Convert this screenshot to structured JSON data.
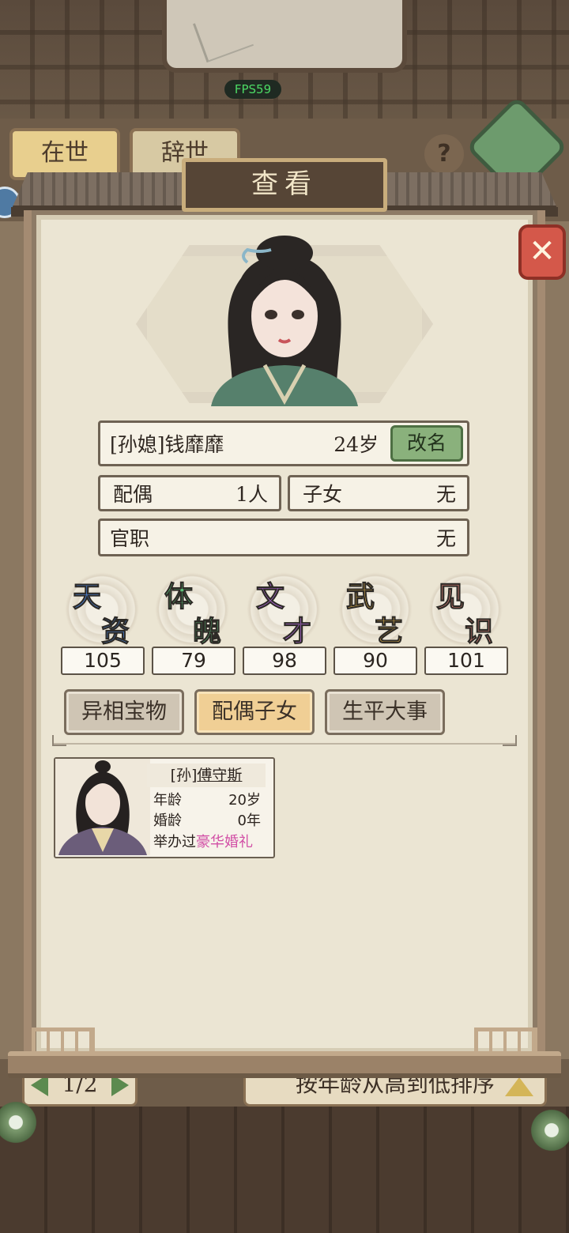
{
  "hud": {
    "fps": "FPS59"
  },
  "background": {
    "tabs": [
      "在世",
      "辞世"
    ],
    "help_icon": "question-mark-icon",
    "back_icon": "return-arrow-icon",
    "pager": "1/2",
    "sort_label": "按年龄从高到低排序"
  },
  "modal": {
    "title": "查看",
    "close_icon": "close-x-icon"
  },
  "person": {
    "name": "[孙媳]钱靡靡",
    "age": "24岁",
    "rename_label": "改名",
    "spouse_label": "配偶",
    "spouse_value": "1人",
    "children_label": "子女",
    "children_value": "无",
    "office_label": "官职",
    "office_value": "无"
  },
  "stats": [
    {
      "c1": "天",
      "c2": "资",
      "value": "105",
      "color": "#4a86e0"
    },
    {
      "c1": "体",
      "c2": "魄",
      "value": "79",
      "color": "#5fbf7a"
    },
    {
      "c1": "文",
      "c2": "才",
      "value": "98",
      "color": "#b06ad8"
    },
    {
      "c1": "武",
      "c2": "艺",
      "value": "90",
      "color": "#e3b448"
    },
    {
      "c1": "见",
      "c2": "识",
      "value": "101",
      "color": "#e0857a"
    }
  ],
  "tabs": [
    {
      "label": "异相宝物",
      "active": false
    },
    {
      "label": "配偶子女",
      "active": true
    },
    {
      "label": "生平大事",
      "active": false
    }
  ],
  "spouse_card": {
    "prefix": "[孙]",
    "name": "傅守斯",
    "age_label": "年龄",
    "age_value": "20岁",
    "marriage_label": "婚龄",
    "marriage_value": "0年",
    "wedding_prefix": "举办过",
    "wedding_type": "豪华婚礼"
  }
}
